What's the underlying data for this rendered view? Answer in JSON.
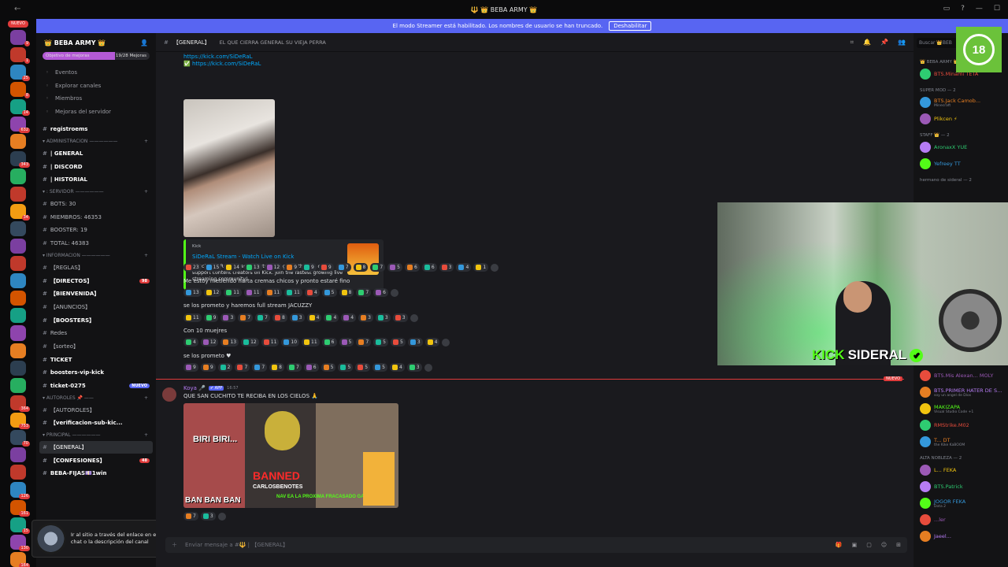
{
  "window": {
    "title": "🔱 👑 BEBA ARMY 👑"
  },
  "banner": {
    "text": "El modo Streamer está habilitado. Los nombres de usuario se han truncado.",
    "button": "Deshabilitar"
  },
  "guild_rail": {
    "new_label": "NUEVO",
    "badges": [
      "9",
      "1",
      "25",
      "8",
      "14",
      "632",
      "",
      "343",
      "",
      "",
      "34",
      "",
      "",
      "",
      "",
      "",
      "",
      "",
      "",
      "",
      "",
      "364",
      "753",
      "70",
      "",
      "",
      "126",
      "161",
      "15",
      "130",
      "164"
    ]
  },
  "server": {
    "name": "👑 BEBA ARMY 👑",
    "boost_goal": "Objetivo de mejoras",
    "boost_count": "19/28 Mejoras",
    "boost_progress": 0.68,
    "menu": [
      {
        "icon": "calendar-icon",
        "label": "Eventos"
      },
      {
        "icon": "compass-icon",
        "label": "Explorar canales"
      },
      {
        "icon": "members-icon",
        "label": "Miembros"
      },
      {
        "icon": "boost-icon",
        "label": "Mejoras del servidor"
      }
    ],
    "sections": [
      {
        "category": "",
        "channels": [
          {
            "name": "registroems",
            "bold": true
          }
        ]
      },
      {
        "category": "ADMINISTRACION ——————",
        "channels": [
          {
            "name": "| GENERAL",
            "bold": true
          },
          {
            "name": "| DISCORD",
            "bold": true
          },
          {
            "name": "| HISTORIAL",
            "bold": true
          }
        ]
      },
      {
        "category": ": SERVIDOR ——————",
        "channels": [
          {
            "name": "BOTS: 30"
          },
          {
            "name": "MIEMBROS: 46353"
          },
          {
            "name": "BOOSTER: 19"
          },
          {
            "name": "TOTAL: 46383"
          }
        ]
      },
      {
        "category": "INFORMACION ——————",
        "channels": [
          {
            "name": "【REGLAS】"
          },
          {
            "name": "【DIRECTOS】",
            "bold": true,
            "badge": "98"
          },
          {
            "name": "【BIENVENIDA】",
            "bold": true
          },
          {
            "name": "【ANUNCIOS】"
          },
          {
            "name": "【BOOSTERS】",
            "bold": true
          },
          {
            "name": "Redes"
          },
          {
            "name": "【sorteo】"
          },
          {
            "name": "TICKET",
            "bold": true
          },
          {
            "name": "boosters-vip-kick",
            "bold": true
          },
          {
            "name": "ticket-0275",
            "bold": true,
            "nuevo": "NUEVO"
          }
        ]
      },
      {
        "category": "AUTOROLES 📌 ——",
        "channels": [
          {
            "name": "【AUTOROLES】"
          },
          {
            "name": "【verificacion-sub-kic...",
            "bold": true
          }
        ]
      },
      {
        "category": "PRINCIPAL ——————",
        "channels": [
          {
            "name": "【GENERAL】",
            "active": true
          },
          {
            "name": "【CONFESIONES】",
            "bold": true,
            "badge": "48"
          },
          {
            "name": "BEBA-FIJAS💷1win",
            "bold": true
          }
        ]
      }
    ]
  },
  "ad": {
    "text": "Ir al sitio a través del enlace en el chat o la descripción del canal"
  },
  "channel": {
    "name": "【GENERAL】",
    "topic": "EL QUE CIERRA GENERAL SU VIEJA PERRA",
    "composer_placeholder": "Enviar mensaje a #🔱 | 【GENERAL】"
  },
  "messages": {
    "links": [
      "https://kick.com/SiDeRaL",
      "✅ https://kick.com/SiDeRaL"
    ],
    "embed": {
      "provider": "Kick",
      "title": "SiDeRaL Stream - Watch Live on Kick",
      "description": "Watch SiDeRaL's latest live streams, get in the live chat & support content creators on Kick. Join the fastest growing live streaming community!"
    },
    "reaction_rows": [
      [
        "23",
        "15",
        "14",
        "13",
        "12",
        "9",
        "9",
        "9",
        "7",
        "8",
        "7",
        "5",
        "6",
        "6",
        "3",
        "4",
        "1"
      ],
      [
        "13",
        "12",
        "11",
        "11",
        "11",
        "11",
        "4",
        "5",
        "8",
        "7",
        "6"
      ],
      [
        "11",
        "9",
        "3",
        "7",
        "7",
        "8",
        "3",
        "4",
        "4",
        "4",
        "3",
        "3",
        "3"
      ],
      [
        "4",
        "12",
        "13",
        "12",
        "11",
        "10",
        "11",
        "6",
        "5",
        "7",
        "5",
        "5",
        "3",
        "4"
      ],
      [
        "9",
        "9",
        "2",
        "7",
        "7",
        "8",
        "7",
        "6",
        "5",
        "5",
        "5",
        "5",
        "4",
        "3"
      ]
    ],
    "lines": [
      "Me estoy metiendo harta cremas chicos y pronto estaré fino",
      "se los prometo y haremos full stream JACUZZY",
      "Con 10 muejres",
      "se los prometo ♥"
    ],
    "new_tag": "NUEVO",
    "koya": {
      "name": "Koya 🎤",
      "app": "✔ APP",
      "time": "16:57",
      "text": "QUE SAN CUCHITO TE RECIBA EN LOS CIELOS 🙏",
      "reactions": [
        "7",
        "3"
      ],
      "meme": {
        "caption1": "BIRI BIRI...",
        "caption2": "BAN BAN BAN",
        "banned": "BANNED",
        "name": "CARLOSBENOTES",
        "sub": "NAV EA LA PROXIMA FRACASADO GAA"
      }
    }
  },
  "members": {
    "search": "Buscar 👑BEB",
    "groups": [
      {
        "title": "👑 BEBA ARMY 👑",
        "items": [
          {
            "name": "BTS.Minami",
            "tag": "TETA"
          }
        ]
      },
      {
        "title": "SUPER MOD — 2",
        "items": [
          {
            "name": "BTS.Jack Camob...",
            "sub": "Minecraft"
          },
          {
            "name": "Plikcen ⚡"
          }
        ]
      },
      {
        "title": "STAFF 👑 — 2",
        "items": [
          {
            "name": "AronaxX",
            "tag": "YUE"
          },
          {
            "name": "Yefreey",
            "tag": "TT"
          }
        ]
      },
      {
        "title": "hermano de sideral — 2",
        "items": []
      },
      {
        "title": "",
        "items": [
          {
            "name": "BTS.Mis Alexan...",
            "tag": "MOLY"
          },
          {
            "name": "BTS.PRIMER HATER DE S...",
            "sub": "soy un angel de Dios"
          },
          {
            "name": "MAKIZAPA",
            "sub": "Visual Studio Code +1"
          },
          {
            "name": "RMStrike.M02"
          },
          {
            "name": "T...",
            "tag": "DT",
            "sub": "the Kike KaBOOM"
          }
        ]
      },
      {
        "title": "ALTA NOBLEZA — 2",
        "items": [
          {
            "name": "L...",
            "tag": "FEKA"
          },
          {
            "name": "BTS.Patrick"
          },
          {
            "name": "JOGOR",
            "tag": "FEKA",
            "sub": "Dota 2"
          },
          {
            "name": "...ler"
          },
          {
            "name": "Jaeel..."
          }
        ]
      }
    ]
  },
  "overlay": {
    "rating": "18",
    "brand_a": "KICK",
    "brand_b": "SIDERAL"
  },
  "colors": {
    "accent": "#5865f2",
    "kick_green": "#53fc18",
    "alert_red": "#e03b3b",
    "link": "#00a8fc"
  }
}
